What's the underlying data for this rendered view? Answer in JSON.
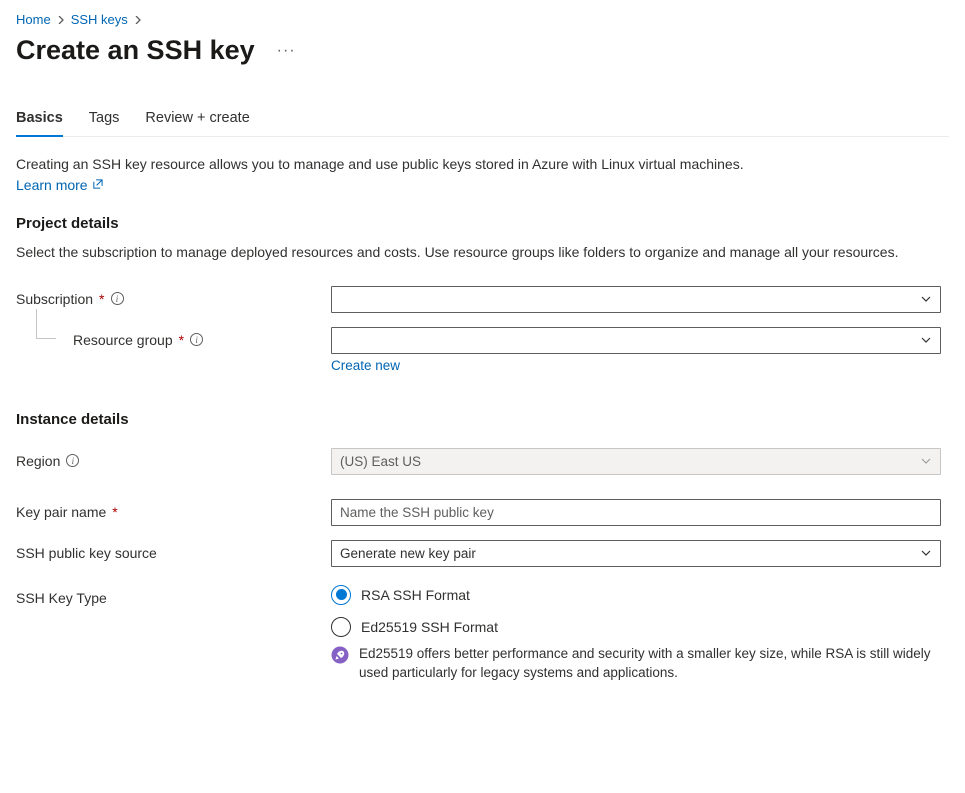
{
  "breadcrumb": {
    "home": "Home",
    "sshkeys": "SSH keys"
  },
  "pageTitle": "Create an SSH key",
  "tabs": {
    "basics": "Basics",
    "tags": "Tags",
    "reviewCreate": "Review + create"
  },
  "intro": {
    "text": "Creating an SSH key resource allows you to manage and use public keys stored in Azure with Linux virtual machines.",
    "learnMore": "Learn more"
  },
  "projectDetails": {
    "heading": "Project details",
    "desc": "Select the subscription to manage deployed resources and costs. Use resource groups like folders to organize and manage all your resources.",
    "subscriptionLabel": "Subscription",
    "resourceGroupLabel": "Resource group",
    "createNew": "Create new"
  },
  "instanceDetails": {
    "heading": "Instance details",
    "regionLabel": "Region",
    "regionValue": "(US) East US",
    "keyPairNameLabel": "Key pair name",
    "keyPairNamePlaceholder": "Name the SSH public key",
    "sshPublicKeySourceLabel": "SSH public key source",
    "sshPublicKeySourceValue": "Generate new key pair",
    "sshKeyTypeLabel": "SSH Key Type",
    "radioRsa": "RSA SSH Format",
    "radioEd25519": "Ed25519 SSH Format",
    "noteText": "Ed25519 offers better performance and security with a smaller key size, while RSA is still widely used particularly for legacy systems and applications."
  }
}
